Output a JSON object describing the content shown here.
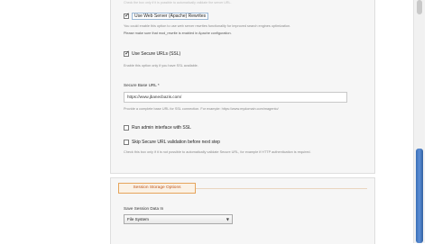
{
  "top_note": "Check the box only if it is possible to automatically validate the server URL.",
  "web_server_rewrites": {
    "label": "Use Web Server (Apache) Rewrites",
    "checked": true,
    "note_1": "You could enable this option to use web server rewrites functionality for improved search engines optimization.",
    "note_2": "Please make sure that mod_rewrite is enabled in Apache configuration."
  },
  "secure_urls": {
    "label": "Use Secure URLs (SSL)",
    "checked": true,
    "note": "Enable this option only if you have SSL available."
  },
  "secure_base_url": {
    "label": "Secure Base URL *",
    "value": "https://www.jbanecbazis.com/",
    "note": "Provide a complete base URL for SSL connection. For example: https://www.mydomain.com/magento/"
  },
  "admin_ssl": {
    "label": "Run admin interface with SSL",
    "checked": false
  },
  "skip_validation": {
    "label": "Skip Secure URL validation before next step",
    "checked": false,
    "note": "Check this box only if it is not possible to automatically validate Secure URL, for example if HTTP authentication is required."
  },
  "session_storage": {
    "legend": "Session Storage Options",
    "field_label": "Save Session Data In",
    "selected": "File System"
  }
}
